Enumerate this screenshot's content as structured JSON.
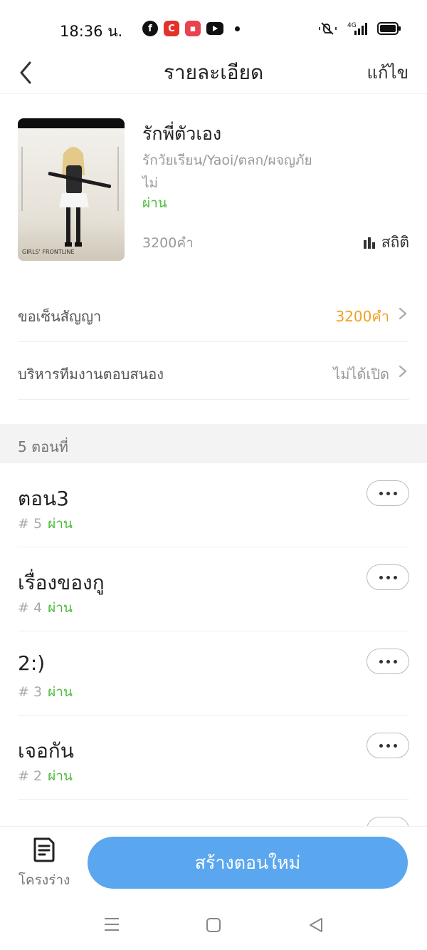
{
  "status_bar": {
    "time": "18:36 น.",
    "network": "4G"
  },
  "header": {
    "title": "รายละเอียด",
    "edit_label": "แก้ไข"
  },
  "book": {
    "title": "รักพี่ตัวเอง",
    "tags": "รักวัยเรียน/Yaoi/ตลก/ผจญภัย",
    "line3": "ไม่",
    "status": "ผ่าน",
    "word_count": "3200คำ",
    "stats_label": "สถิติ",
    "cover_text": "GIRLS' FRONTLINE"
  },
  "settings": [
    {
      "label": "ขอเซ็นสัญญา",
      "value": "3200คำ",
      "value_color": "#f0a020"
    },
    {
      "label": "บริหารทีมงานตอบสนอง",
      "value": "ไม่ได้เปิด",
      "value_color": "#999999"
    }
  ],
  "section": {
    "label": "5 ตอนที่"
  },
  "episodes": [
    {
      "title": "ตอน3",
      "number": "# 5",
      "status": "ผ่าน"
    },
    {
      "title": "เรื่องของกู",
      "number": "# 4",
      "status": "ผ่าน"
    },
    {
      "title": "2:)",
      "number": "# 3",
      "status": "ผ่าน"
    },
    {
      "title": "เจอกัน",
      "number": "# 2",
      "status": "ผ่าน"
    }
  ],
  "bottom": {
    "outline_label": "โครงร่าง",
    "create_button": "สร้างตอนใหม่"
  },
  "colors": {
    "accent": "#5aa7ef",
    "pass": "#4cbb3a",
    "contract": "#f0a020"
  }
}
